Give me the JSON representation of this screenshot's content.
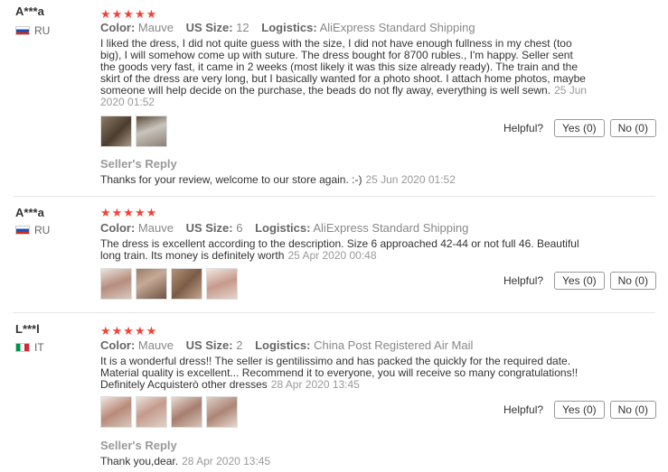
{
  "labels": {
    "color": "Color:",
    "size": "US Size:",
    "logistics": "Logistics:",
    "helpful": "Helpful?",
    "seller_reply": "Seller's Reply"
  },
  "reviews": [
    {
      "user": "A***a",
      "country": "RU",
      "stars": "★★★★★",
      "color": "Mauve",
      "size": "12",
      "logistics": "AliExpress Standard Shipping",
      "text": "I liked the dress, I did not quite guess with the size, I did not have enough fullness in my chest (too big), I will somehow come up with suture. The dress bought for 8700 rubles., I'm happy. Seller sent the goods very fast, it came in 2 weeks (most likely it was this size already ready). The train and the skirt of the dress are very long, but I basically wanted for a photo shoot. I attach home photos, maybe someone will help decide on the purchase, the beads do not fly away, everything is well sewn.",
      "date": "25 Jun 2020 01:52",
      "yes": "Yes (0)",
      "no": "No (0)",
      "reply": "Thanks for your review, welcome to our store again. :-)",
      "reply_date": "25 Jun 2020 01:52"
    },
    {
      "user": "A***a",
      "country": "RU",
      "stars": "★★★★★",
      "color": "Mauve",
      "size": "6",
      "logistics": "AliExpress Standard Shipping",
      "text": "The dress is excellent according to the description. Size 6 approached 42-44 or not full 46. Beautiful long train. Its money is definitely worth",
      "date": "25 Apr 2020 00:48",
      "yes": "Yes (0)",
      "no": "No (0)"
    },
    {
      "user": "L***l",
      "country": "IT",
      "stars": "★★★★★",
      "color": "Mauve",
      "size": "2",
      "logistics": "China Post Registered Air Mail",
      "text": "It is a wonderful dress!! The seller is gentilissimo and has packed the quickly for the required date. Material quality is excellent... Recommend it to everyone, you will receive so many congratulations!! Definitely Acquisterò other dresses",
      "date": "28 Apr 2020 13:45",
      "yes": "Yes (0)",
      "no": "No (0)",
      "reply": "Thank you,dear.",
      "reply_date": "28 Apr 2020 13:45"
    }
  ],
  "colors": {
    "star": "#f44336",
    "meta_value": "#888888",
    "reply_title": "#999999"
  }
}
